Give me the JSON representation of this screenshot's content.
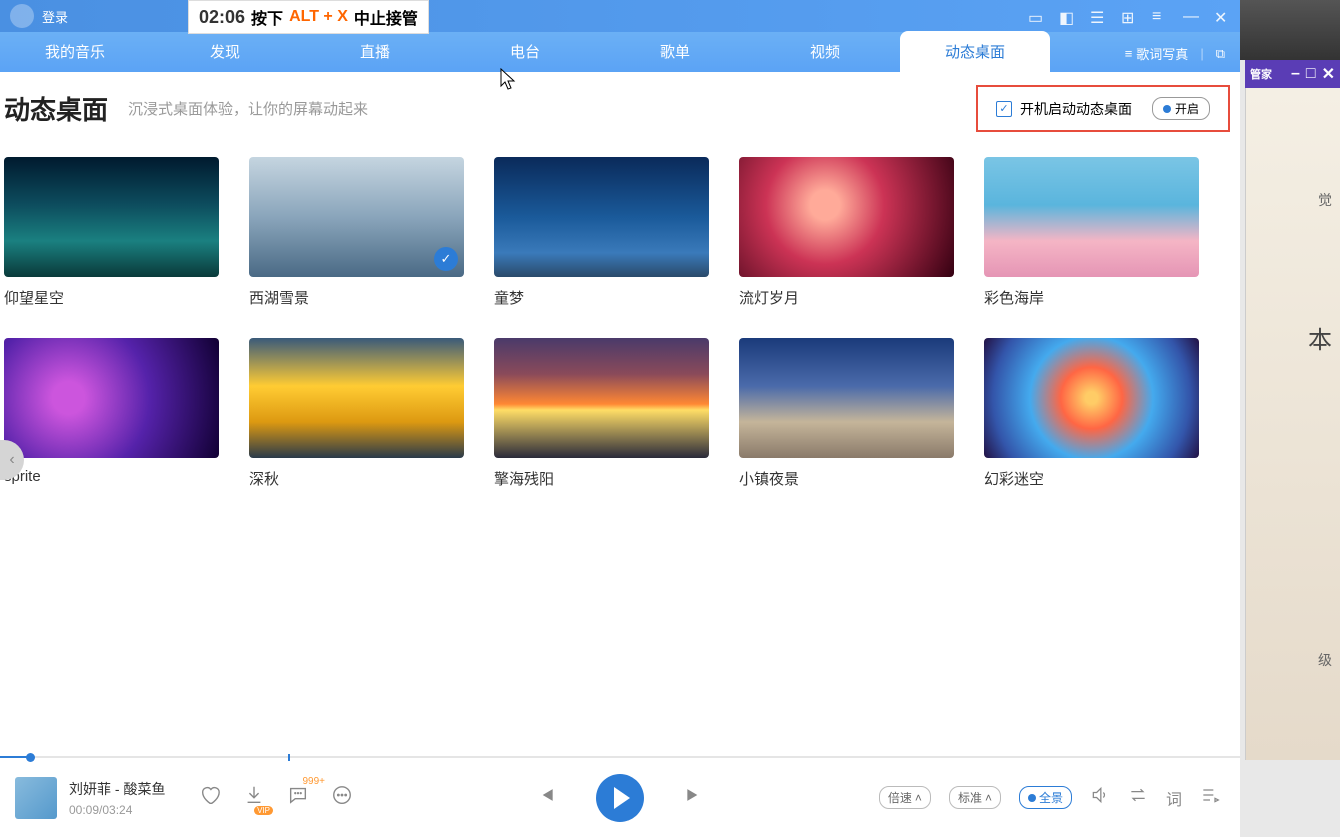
{
  "header": {
    "login": "登录"
  },
  "tooltip": {
    "time": "02:06",
    "before": "按下",
    "key": "ALT + X",
    "after": "中止接管"
  },
  "tabs": {
    "items": [
      "我的音乐",
      "发现",
      "直播",
      "电台",
      "歌单",
      "视频",
      "动态桌面"
    ],
    "right": {
      "lyrics": "歌词写真"
    }
  },
  "page": {
    "title": "动态桌面",
    "subtitle": "沉浸式桌面体验，让你的屏幕动起来",
    "checkbox_label": "开机启动动态桌面",
    "toggle_label": "开启"
  },
  "wallpapers": [
    {
      "title": "仰望星空",
      "thumb_class": "t1",
      "checked": false
    },
    {
      "title": "西湖雪景",
      "thumb_class": "t2",
      "checked": true
    },
    {
      "title": "童梦",
      "thumb_class": "t3",
      "checked": false
    },
    {
      "title": "流灯岁月",
      "thumb_class": "t4",
      "checked": false
    },
    {
      "title": "彩色海岸",
      "thumb_class": "t5",
      "checked": false
    },
    {
      "title": "sprite",
      "thumb_class": "t6",
      "checked": false
    },
    {
      "title": "深秋",
      "thumb_class": "t7",
      "checked": false
    },
    {
      "title": "擎海残阳",
      "thumb_class": "t8",
      "checked": false
    },
    {
      "title": "小镇夜景",
      "thumb_class": "t9",
      "checked": false
    },
    {
      "title": "幻彩迷空",
      "thumb_class": "t10",
      "checked": false
    }
  ],
  "player": {
    "song": "刘妍菲 - 酸菜鱼",
    "time": "00:09/03:24",
    "comments_badge": "999+",
    "speed": "倍速",
    "quality": "标准",
    "panorama": "全景",
    "lyrics": "词"
  },
  "sidebar": {
    "app": "管家",
    "text1": "觉",
    "text2": "本",
    "text3": "级"
  }
}
